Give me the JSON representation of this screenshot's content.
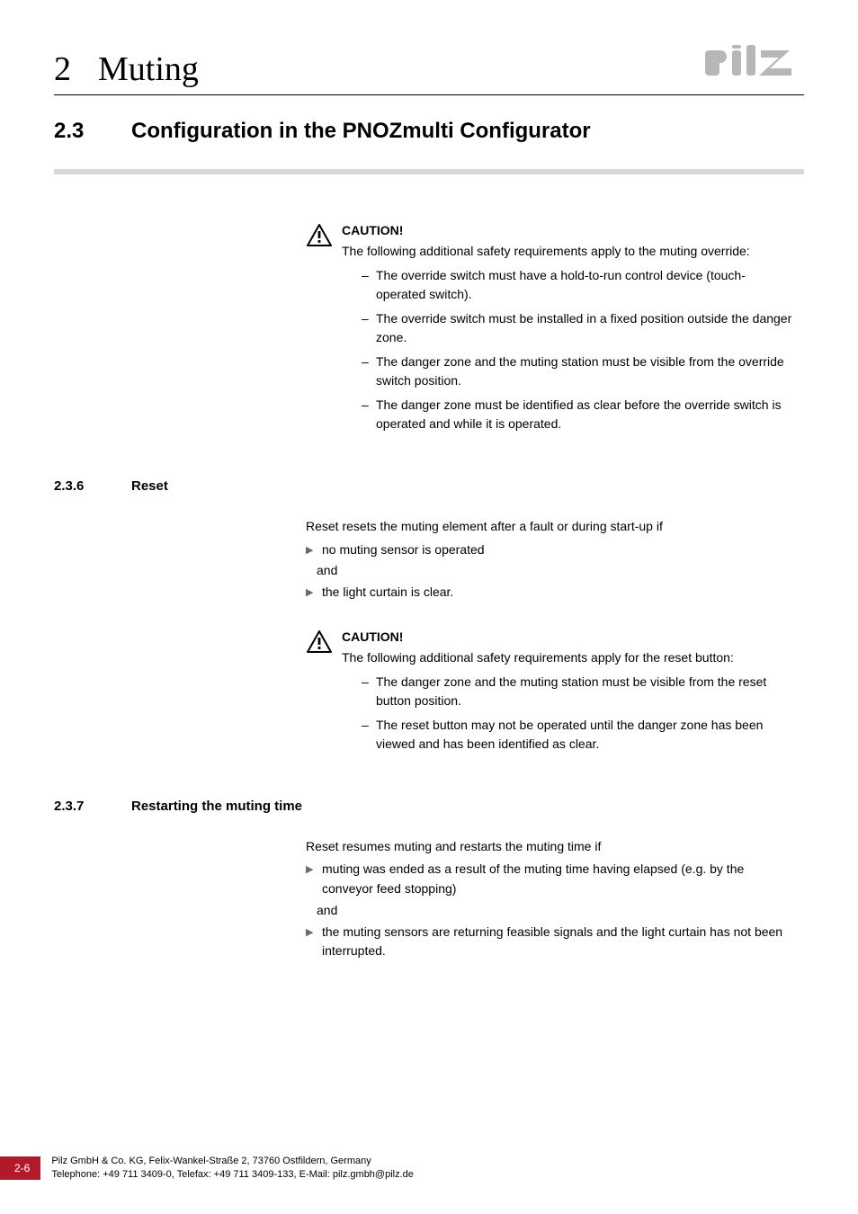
{
  "header": {
    "chapter_number": "2",
    "chapter_title": "Muting"
  },
  "logo_alt": "pilz",
  "section": {
    "number": "2.3",
    "title": "Configuration in the PNOZmulti Configurator"
  },
  "caution1": {
    "label": "CAUTION!",
    "intro": "The following additional safety requirements apply to the muting override:",
    "items": [
      "The override switch must have a hold-to-run control device (touch-operated switch).",
      "The override switch must be installed in a fixed position outside the danger zone.",
      "The danger zone and the muting station must be visible from the override switch position.",
      "The danger zone must be identified as clear before the override switch is operated and while it is operated."
    ]
  },
  "sub236": {
    "number": "2.3.6",
    "title": "Reset",
    "intro": "Reset resets the muting element after a fault or during start-up if",
    "bullets": [
      "no muting sensor is operated",
      "the light curtain is clear."
    ],
    "and": "and"
  },
  "caution2": {
    "label": "CAUTION!",
    "intro": "The following additional safety requirements apply for the reset button:",
    "items": [
      "The danger zone and the muting station must be visible from the reset button position.",
      "The reset button may not be operated until the danger zone has been viewed and has been identified as clear."
    ]
  },
  "sub237": {
    "number": "2.3.7",
    "title": "Restarting the muting time",
    "intro": "Reset resumes muting and restarts the muting time if",
    "bullets": [
      "muting was ended as a result of the muting time having elapsed (e.g. by the conveyor feed stopping)",
      "the muting sensors are returning feasible signals and the light curtain has not been interrupted."
    ],
    "and": "and"
  },
  "footer": {
    "page_number": "2-6",
    "line1": "Pilz GmbH & Co. KG, Felix-Wankel-Straße 2, 73760 Ostfildern, Germany",
    "line2": "Telephone: +49 711 3409-0, Telefax: +49 711 3409-133, E-Mail: pilz.gmbh@pilz.de"
  }
}
